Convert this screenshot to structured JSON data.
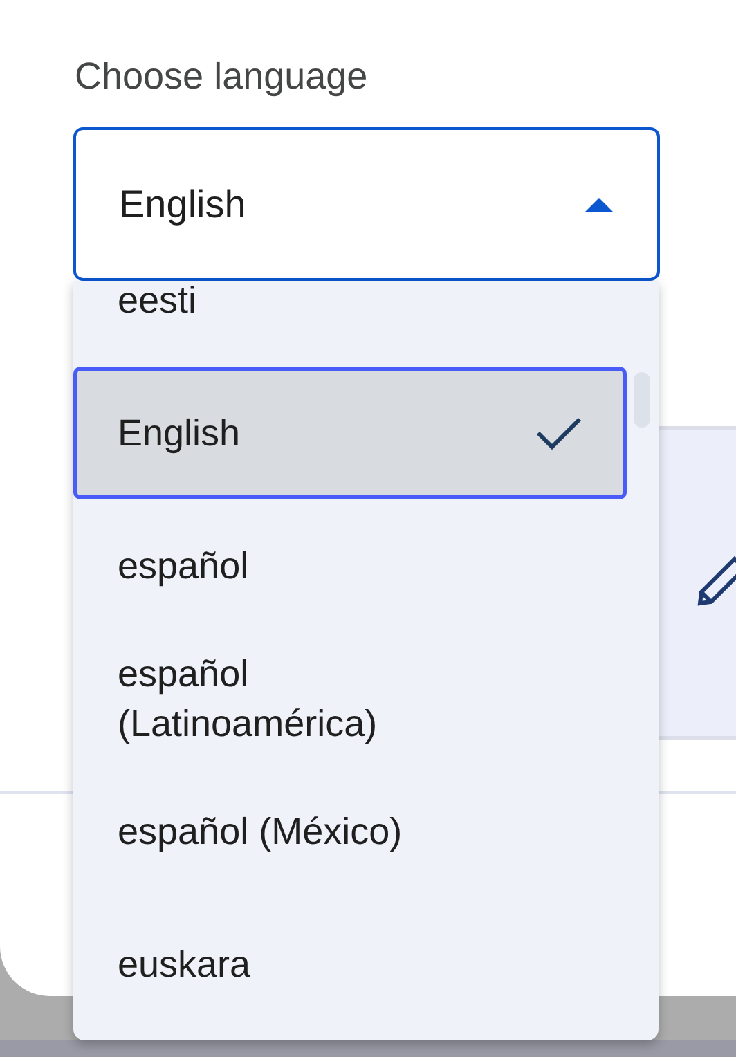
{
  "label": "Choose language",
  "field": {
    "value": "English",
    "expanded": true
  },
  "options": [
    {
      "label": "eesti",
      "selected": false
    },
    {
      "label": "English",
      "selected": true
    },
    {
      "label": "español",
      "selected": false
    },
    {
      "label": "español (Latinoamérica)",
      "selected": false
    },
    {
      "label": "español (México)",
      "selected": false
    },
    {
      "label": "euskara",
      "selected": false
    }
  ]
}
